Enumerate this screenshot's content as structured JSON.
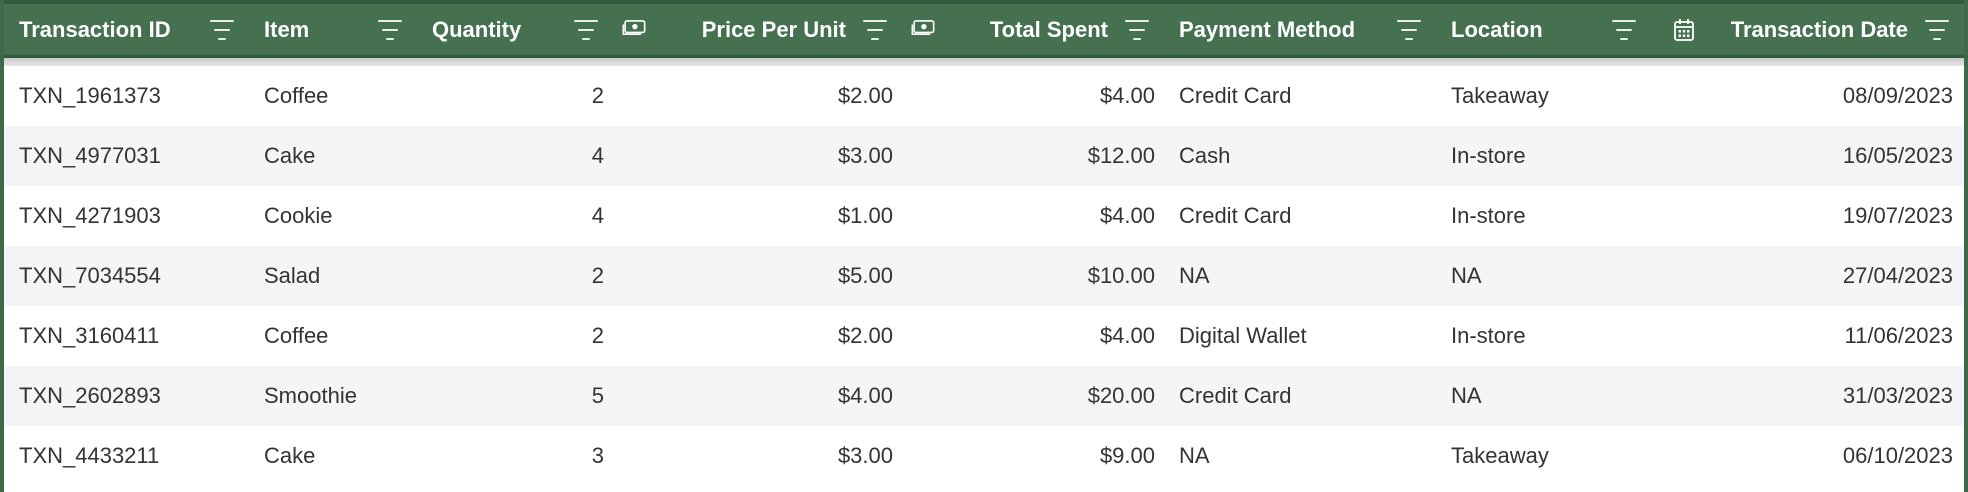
{
  "columns": [
    {
      "label": "Transaction ID"
    },
    {
      "label": "Item"
    },
    {
      "label": "Quantity"
    },
    {
      "label": "Price Per Unit",
      "icon": "money-icon"
    },
    {
      "label": "Total Spent",
      "icon": "money-icon"
    },
    {
      "label": "Payment Method"
    },
    {
      "label": "Location"
    },
    {
      "label": "Transaction Date",
      "icon": "calendar-icon"
    }
  ],
  "rows": [
    [
      "TXN_1961373",
      "Coffee",
      "2",
      "$2.00",
      "$4.00",
      "Credit Card",
      "Takeaway",
      "08/09/2023"
    ],
    [
      "TXN_4977031",
      "Cake",
      "4",
      "$3.00",
      "$12.00",
      "Cash",
      "In-store",
      "16/05/2023"
    ],
    [
      "TXN_4271903",
      "Cookie",
      "4",
      "$1.00",
      "$4.00",
      "Credit Card",
      "In-store",
      "19/07/2023"
    ],
    [
      "TXN_7034554",
      "Salad",
      "2",
      "$5.00",
      "$10.00",
      "NA",
      "NA",
      "27/04/2023"
    ],
    [
      "TXN_3160411",
      "Coffee",
      "2",
      "$2.00",
      "$4.00",
      "Digital Wallet",
      "In-store",
      "11/06/2023"
    ],
    [
      "TXN_2602893",
      "Smoothie",
      "5",
      "$4.00",
      "$20.00",
      "Credit Card",
      "NA",
      "31/03/2023"
    ],
    [
      "TXN_4433211",
      "Cake",
      "3",
      "$3.00",
      "$9.00",
      "NA",
      "Takeaway",
      "06/10/2023"
    ]
  ],
  "colors": {
    "header_bg": "#467151",
    "header_border": "#2f5a3c",
    "row_alt_bg": "#f5f5f7",
    "text": "#333333"
  }
}
